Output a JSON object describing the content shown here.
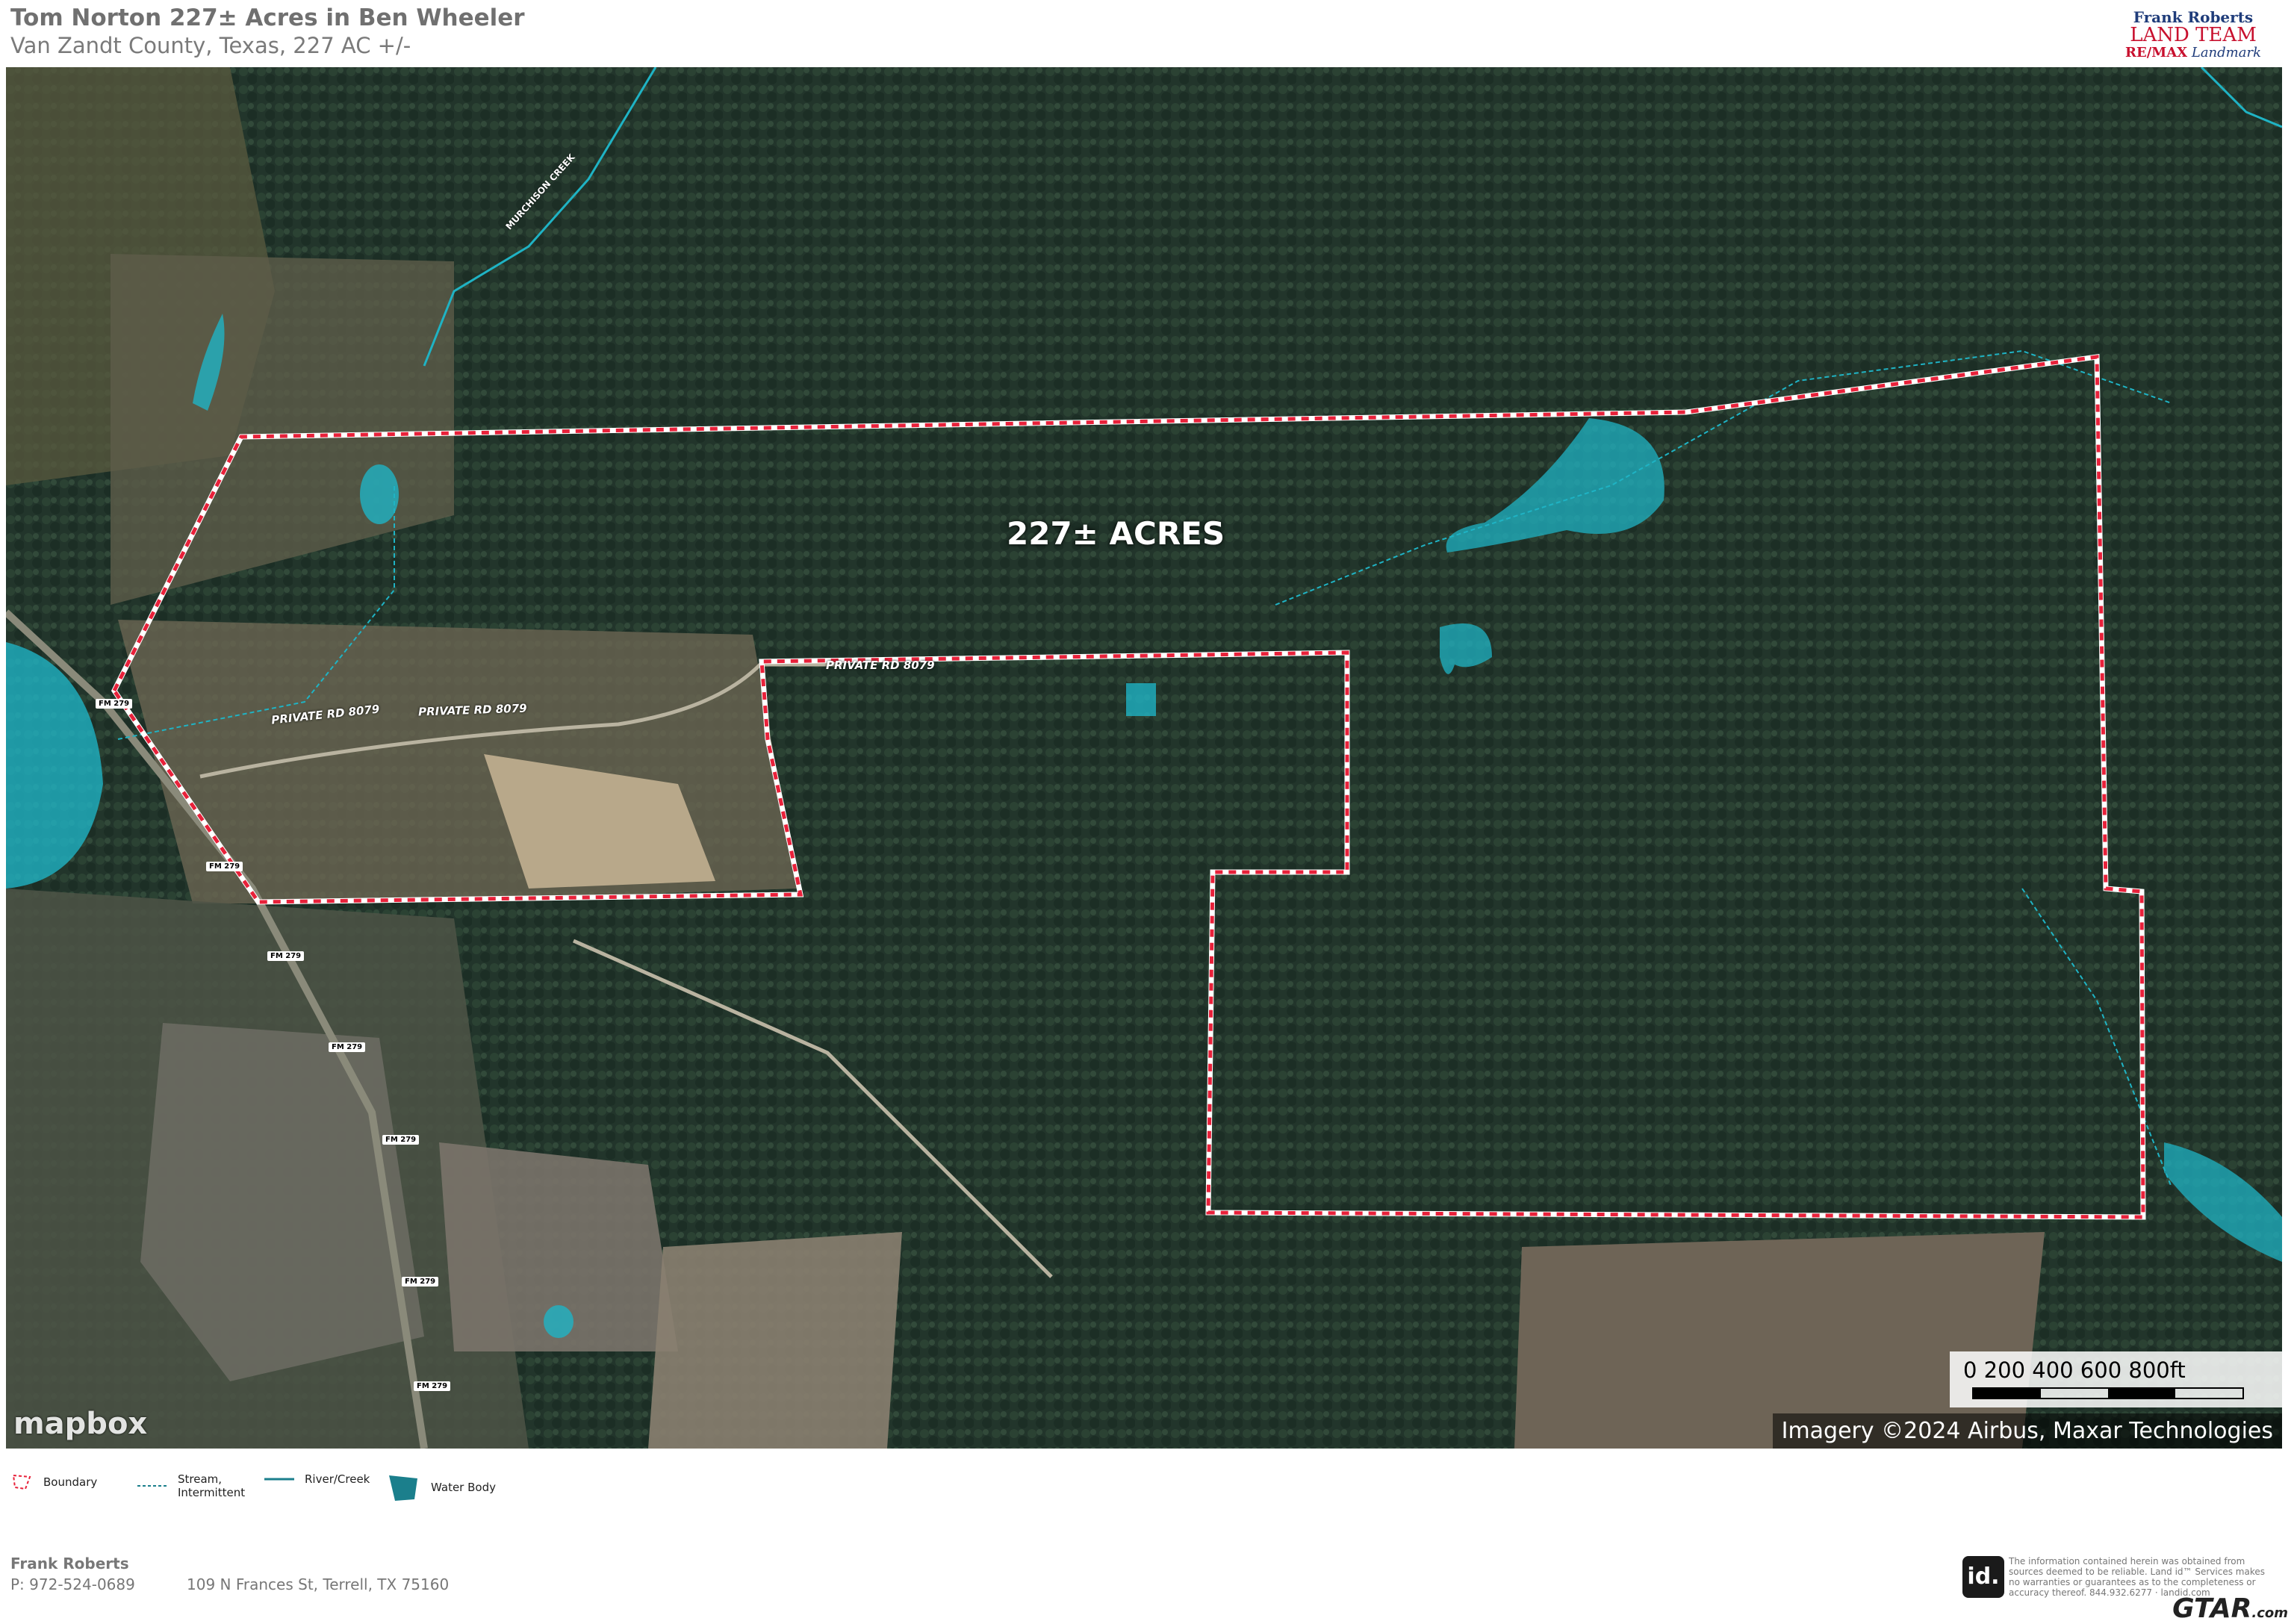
{
  "header": {
    "title": "Tom Norton 227± Acres in Ben Wheeler",
    "subtitle": "Van Zandt County, Texas, 227 AC +/-"
  },
  "logo": {
    "line1": "Frank Roberts",
    "line2": "LAND TEAM",
    "line3_brand": "RE/MAX",
    "line3_suffix": "Landmark"
  },
  "map": {
    "acres_label": "227± ACRES",
    "roads": {
      "private_rd_1": "PRIVATE RD 8079",
      "private_rd_2": "PRIVATE RD 8079",
      "private_rd_3": "PRIVATE RD 8079"
    },
    "fm_labels": [
      "FM 279",
      "FM 279",
      "FM 279",
      "FM 279",
      "FM 279",
      "FM 279",
      "FM 279"
    ],
    "creek_label": "MURCHISON CREEK",
    "mapbox": "mapbox",
    "imagery": "Imagery ©2024 Airbus, Maxar Technologies",
    "scale": {
      "labels": "0 200 400 600 800ft"
    },
    "colors": {
      "boundary": "#e8213a",
      "water": "#1fb3c4",
      "forest": "#22352b"
    }
  },
  "legend": {
    "boundary": "Boundary",
    "stream": "Stream, Intermittent",
    "river": "River/Creek",
    "water": "Water Body"
  },
  "footer": {
    "name": "Frank Roberts",
    "phone": "P: 972-524-0689",
    "address": "109 N Frances St, Terrell, TX 75160",
    "id_logo": "id.",
    "disclaimer": "The information contained herein was obtained from sources deemed to be reliable. Land id™ Services makes no warranties or guarantees as to the completeness or accuracy thereof. 844.932.6277 · landid.com",
    "gtar": "GTAR",
    "gtar_suffix": ".com"
  }
}
